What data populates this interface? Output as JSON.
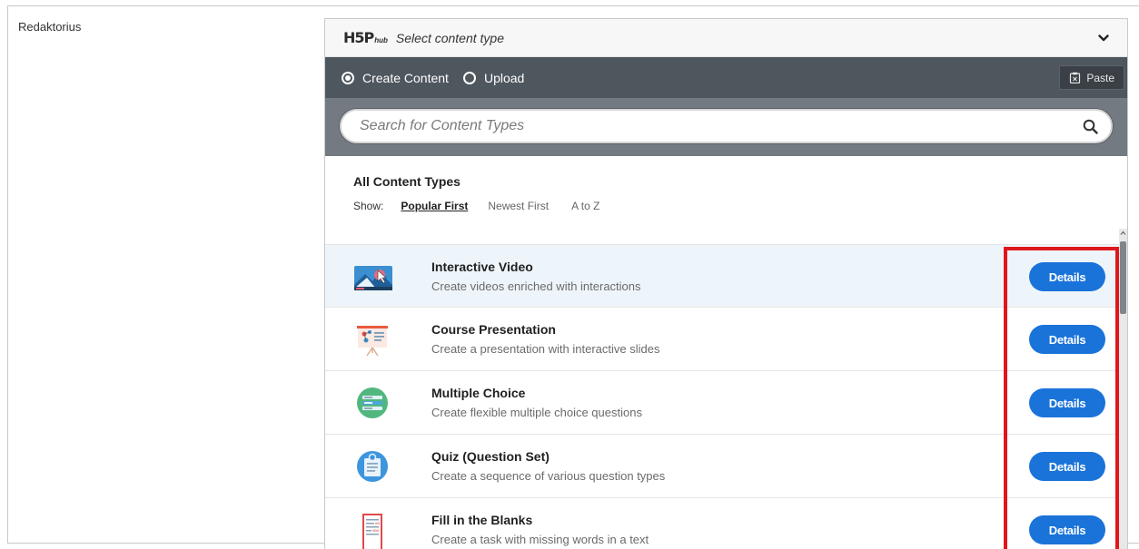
{
  "field": {
    "label": "Redaktorius"
  },
  "hub": {
    "logo": "H5P",
    "logo_sub": "hub",
    "header_title": "Select content type",
    "tabs": [
      {
        "label": "Create Content",
        "selected": true
      },
      {
        "label": "Upload",
        "selected": false
      }
    ],
    "paste_label": "Paste",
    "search": {
      "placeholder": "Search for Content Types",
      "value": ""
    },
    "all_types_title": "All Content Types",
    "show_label": "Show:",
    "sort_options": [
      {
        "label": "Popular First",
        "active": true
      },
      {
        "label": "Newest First",
        "active": false
      },
      {
        "label": "A to Z",
        "active": false
      }
    ],
    "content_types": [
      {
        "name": "Interactive Video",
        "description": "Create videos enriched with interactions",
        "button": "Details",
        "icon": "interactive-video-icon"
      },
      {
        "name": "Course Presentation",
        "description": "Create a presentation with interactive slides",
        "button": "Details",
        "icon": "course-presentation-icon"
      },
      {
        "name": "Multiple Choice",
        "description": "Create flexible multiple choice questions",
        "button": "Details",
        "icon": "multiple-choice-icon"
      },
      {
        "name": "Quiz (Question Set)",
        "description": "Create a sequence of various question types",
        "button": "Details",
        "icon": "question-set-icon"
      },
      {
        "name": "Fill in the Blanks",
        "description": "Create a task with missing words in a text",
        "button": "Details",
        "icon": "fill-in-blanks-icon"
      }
    ]
  },
  "colors": {
    "tab_bar": "#4e565e",
    "search_bar": "#737a81",
    "details_button": "#1a73d9",
    "highlight": "#e0161c"
  }
}
